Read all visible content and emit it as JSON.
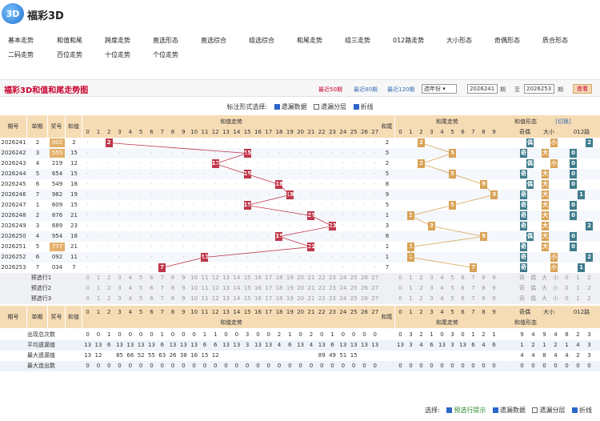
{
  "app": {
    "logo_text": "3D",
    "title": "福彩3D"
  },
  "nav": {
    "row1": [
      "基本走势",
      "和值和尾",
      "跨度走势",
      "直选形态",
      "直选综合",
      "组选综合",
      "和尾走势",
      "组三走势",
      "012路走势",
      "大小形态",
      "奇偶形态",
      "质合形态"
    ],
    "row2": [
      "二码走势",
      "百位走势",
      "十位走势",
      "个位走势"
    ]
  },
  "panel": {
    "title": "福彩3D和值和尾走势图",
    "links": [
      "最近50期",
      "最近80期",
      "最近120期"
    ],
    "select": "选年份",
    "from": "2026241",
    "from_suffix": "期",
    "to_prefix": "至",
    "to": "2026253",
    "to_suffix": "期",
    "query": "查看"
  },
  "options": {
    "label": "标注形式选择:",
    "items": [
      "遗漏数据",
      "遗漏分层",
      "折线"
    ]
  },
  "table": {
    "headers": {
      "issue": "期号",
      "unit": "单期",
      "prize": "奖号",
      "sum": "和值",
      "sum_trend": "和值走势",
      "tail": "和尾",
      "tail_trend": "和尾走势",
      "shape": "和值形态",
      "switch": "[切换]",
      "odd_even": "奇偶",
      "big_small": "大小",
      "road": "012路"
    },
    "sum_cols": [
      "0",
      "1",
      "2",
      "3",
      "4",
      "5",
      "6",
      "7",
      "8",
      "9",
      "10",
      "11",
      "12",
      "13",
      "14",
      "15",
      "16",
      "17",
      "18",
      "19",
      "20",
      "21",
      "22",
      "23",
      "24",
      "25",
      "26",
      "27"
    ],
    "tail_cols": [
      "0",
      "1",
      "2",
      "3",
      "4",
      "5",
      "6",
      "7",
      "8",
      "9"
    ],
    "shape_cols": [
      "奇",
      "偶",
      "大",
      "小",
      "0",
      "1",
      "2"
    ],
    "rows": [
      {
        "issue": "2026241",
        "a": "2",
        "prize": "002",
        "sum": "2",
        "tail": "2",
        "oe": "偶",
        "bs": "小",
        "r": "2"
      },
      {
        "issue": "2026242",
        "a": "3",
        "prize": "555",
        "sum": "15",
        "tail": "5",
        "oe": "奇",
        "bs": "大",
        "r": "0"
      },
      {
        "issue": "2026243",
        "a": "4",
        "prize": "219",
        "sum": "12",
        "tail": "2",
        "oe": "偶",
        "bs": "小",
        "r": "0"
      },
      {
        "issue": "2026244",
        "a": "5",
        "prize": "654",
        "sum": "15",
        "tail": "5",
        "oe": "奇",
        "bs": "大",
        "r": "0"
      },
      {
        "issue": "2026245",
        "a": "6",
        "prize": "549",
        "sum": "18",
        "tail": "8",
        "oe": "偶",
        "bs": "大",
        "r": "0"
      },
      {
        "issue": "2026246",
        "a": "7",
        "prize": "982",
        "sum": "19",
        "tail": "9",
        "oe": "奇",
        "bs": "大",
        "r": "1"
      },
      {
        "issue": "2026247",
        "a": "1",
        "prize": "609",
        "sum": "15",
        "tail": "5",
        "oe": "奇",
        "bs": "大",
        "r": "0"
      },
      {
        "issue": "2026248",
        "a": "2",
        "prize": "876",
        "sum": "21",
        "tail": "1",
        "oe": "奇",
        "bs": "大",
        "r": "0"
      },
      {
        "issue": "2026249",
        "a": "3",
        "prize": "689",
        "sum": "23",
        "tail": "3",
        "oe": "奇",
        "bs": "大",
        "r": "2"
      },
      {
        "issue": "2026250",
        "a": "4",
        "prize": "954",
        "sum": "18",
        "tail": "8",
        "oe": "偶",
        "bs": "大",
        "r": "0"
      },
      {
        "issue": "2026251",
        "a": "5",
        "prize": "777",
        "sum": "21",
        "tail": "1",
        "oe": "奇",
        "bs": "大",
        "r": "0"
      },
      {
        "issue": "2026252",
        "a": "6",
        "prize": "092",
        "sum": "11",
        "tail": "1",
        "oe": "奇",
        "bs": "小",
        "r": "2"
      },
      {
        "issue": "2026253",
        "a": "7",
        "prize": "034",
        "sum": "7",
        "tail": "7",
        "oe": "奇",
        "bs": "小",
        "r": "1"
      }
    ],
    "predict": [
      "预选行1",
      "预选行2",
      "预选行3"
    ],
    "pred_shape": [
      "奇",
      "偶",
      "大",
      "小",
      "0",
      "1",
      "2"
    ],
    "stats": [
      {
        "label": "出现总次数",
        "sum": [
          "0",
          "0",
          "1",
          "0",
          "0",
          "0",
          "0",
          "1",
          "0",
          "0",
          "0",
          "1",
          "1",
          "0",
          "0",
          "3",
          "0",
          "0",
          "2",
          "1",
          "0",
          "2",
          "0",
          "1",
          "0",
          "0",
          "0",
          "0"
        ],
        "tail": [
          "0",
          "3",
          "2",
          "1",
          "0",
          "3",
          "0",
          "1",
          "2",
          "1"
        ],
        "shape": [
          "9",
          "4",
          "9",
          "4",
          "8",
          "2",
          "3"
        ]
      },
      {
        "label": "平均遗漏值",
        "sum": [
          "13",
          "13",
          "6",
          "13",
          "13",
          "13",
          "13",
          "6",
          "13",
          "13",
          "13",
          "6",
          "6",
          "13",
          "13",
          "3",
          "13",
          "13",
          "4",
          "6",
          "13",
          "4",
          "13",
          "6",
          "13",
          "13",
          "13",
          "13"
        ],
        "tail": [
          "13",
          "3",
          "4",
          "6",
          "13",
          "3",
          "13",
          "6",
          "4",
          "6"
        ],
        "shape": [
          "1",
          "2",
          "1",
          "2",
          "1",
          "4",
          "3"
        ]
      },
      {
        "label": "最大遗漏值",
        "sum": [
          "13",
          "12",
          "",
          "85",
          "66",
          "52",
          "55",
          "63",
          "26",
          "38",
          "16",
          "15",
          "12",
          "",
          "",
          "",
          "",
          "",
          "",
          "",
          "",
          "",
          "89",
          "49",
          "51",
          "15",
          "",
          ""
        ],
        "tail": [
          "",
          "",
          "",
          "",
          "",
          "",
          "",
          "",
          "",
          ""
        ],
        "shape": [
          "4",
          "4",
          "8",
          "4",
          "4",
          "2",
          "3"
        ]
      },
      {
        "label": "最大连出数",
        "sum": [
          "0",
          "0",
          "0",
          "0",
          "0",
          "0",
          "0",
          "0",
          "0",
          "0",
          "0",
          "0",
          "0",
          "0",
          "0",
          "0",
          "0",
          "0",
          "0",
          "0",
          "0",
          "0",
          "0",
          "0",
          "0",
          "0",
          "0",
          "0"
        ],
        "tail": [
          "0",
          "0",
          "0",
          "0",
          "0",
          "0",
          "0",
          "0",
          "0",
          "0"
        ],
        "shape": [
          "0",
          "0",
          "0",
          "0",
          "0",
          "0",
          "0"
        ]
      }
    ]
  },
  "footer": {
    "label": "选择:",
    "items": [
      "预选行提示",
      "遗漏数据",
      "遗漏分层",
      "折线"
    ]
  },
  "colors": {
    "accent": "#c8002d",
    "header": "#f6dcb5",
    "hit": "#c0374b",
    "tail_hit": "#d9a357"
  }
}
